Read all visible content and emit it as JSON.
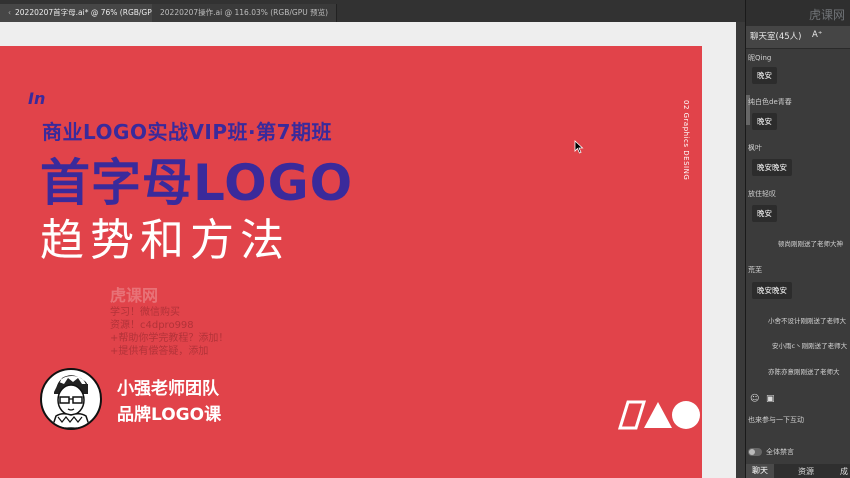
{
  "tabs": [
    {
      "label": "20220207首字母.ai* @ 76% (RGB/GPU 预览)",
      "active": true
    },
    {
      "label": "20220207操作.ai @ 116.03% (RGB/GPU 预览)",
      "active": false
    }
  ],
  "artboard": {
    "in_mark": "In",
    "subtitle": "商业LOGO实战VIP班·第7期班",
    "title_line1": "首字母LOGO",
    "title_line2": "趋势和方法",
    "side_vertical": "02 Graphics DESING",
    "team_name": "小强老师团队",
    "course_name": "品牌LOGO课",
    "watermark": {
      "big": "虎课网",
      "line1": "学习！微信购买",
      "line2": "资源！c4dpro998",
      "line3": "+帮助你学完教程？添加！",
      "line4": "+提供有偿答疑，添加"
    },
    "colors": {
      "background": "#e1434a",
      "primary": "#3a2a9b",
      "white": "#ffffff"
    }
  },
  "panel": {
    "brand": "虎课网",
    "room_title": "聊天室(45人)",
    "font_button": "A⁺",
    "messages": [
      {
        "type": "user",
        "name": "昵Qing",
        "text": "晚安"
      },
      {
        "type": "user",
        "name": "纯白色de青春",
        "text": "晚安"
      },
      {
        "type": "user",
        "name": "枫叶",
        "text": "晚安晚安"
      },
      {
        "type": "user",
        "name": "放住轻叹",
        "text": "晚安"
      },
      {
        "type": "system",
        "text": "顿尚刚刚送了老师大神"
      },
      {
        "type": "user",
        "name": "荒芜",
        "text": "晚安晚安"
      },
      {
        "type": "system",
        "text": "小舍不设计刚刚送了老师大"
      },
      {
        "type": "system",
        "text": "安小雨c丶刚刚送了老师大"
      },
      {
        "type": "system",
        "text": "亦陈亦意刚刚送了老师大"
      }
    ],
    "interact_text": "也来参与一下互动",
    "mute_label": "全体禁言",
    "bottom_tabs": [
      "聊天",
      "资源",
      "成"
    ]
  }
}
